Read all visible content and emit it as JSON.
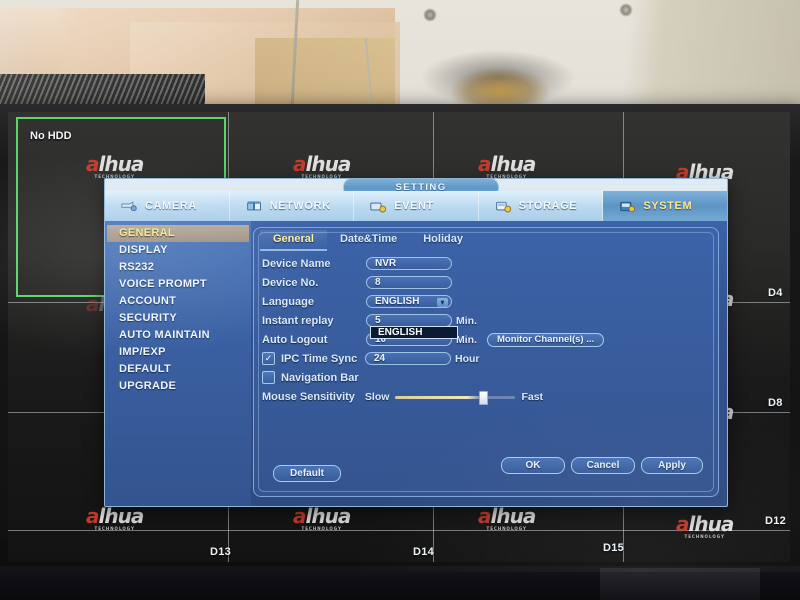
{
  "device_screen": {
    "no_hdd_text": "No HDD",
    "watermark_brand": "alhua",
    "watermark_tagline": "TECHNOLOGY",
    "channel_labels": [
      "D4",
      "D8",
      "D12",
      "D13",
      "D14",
      "D15"
    ]
  },
  "dialog": {
    "title": "SETTING",
    "tabs": [
      {
        "label": "CAMERA",
        "icon": "camera-icon",
        "active": false
      },
      {
        "label": "NETWORK",
        "icon": "network-icon",
        "active": false
      },
      {
        "label": "EVENT",
        "icon": "event-icon",
        "active": false
      },
      {
        "label": "STORAGE",
        "icon": "storage-icon",
        "active": false
      },
      {
        "label": "SYSTEM",
        "icon": "system-icon",
        "active": true
      }
    ],
    "sidebar": [
      {
        "label": "GENERAL",
        "active": true
      },
      {
        "label": "DISPLAY",
        "active": false
      },
      {
        "label": "RS232",
        "active": false
      },
      {
        "label": "VOICE PROMPT",
        "active": false
      },
      {
        "label": "ACCOUNT",
        "active": false
      },
      {
        "label": "SECURITY",
        "active": false
      },
      {
        "label": "AUTO MAINTAIN",
        "active": false
      },
      {
        "label": "IMP/EXP",
        "active": false
      },
      {
        "label": "DEFAULT",
        "active": false
      },
      {
        "label": "UPGRADE",
        "active": false
      }
    ],
    "subtabs": [
      {
        "label": "General",
        "active": true
      },
      {
        "label": "Date&Time",
        "active": false
      },
      {
        "label": "Holiday",
        "active": false
      }
    ],
    "form": {
      "device_name": {
        "label": "Device Name",
        "value": "NVR"
      },
      "device_no": {
        "label": "Device No.",
        "value": "8"
      },
      "language": {
        "label": "Language",
        "value": "ENGLISH",
        "dropdown_open": true,
        "option_highlighted": "ENGLISH"
      },
      "instant_replay": {
        "label": "Instant replay",
        "value": "5",
        "unit": "Min."
      },
      "auto_logout": {
        "label": "Auto Logout",
        "value": "10",
        "unit": "Min.",
        "button": "Monitor Channel(s) ..."
      },
      "ipc_time_sync": {
        "label": "IPC Time Sync",
        "value": "24",
        "unit": "Hour",
        "checked": true
      },
      "navigation_bar": {
        "label": "Navigation Bar",
        "checked": false
      },
      "mouse_sensitivity": {
        "label": "Mouse Sensitivity",
        "min_label": "Slow",
        "max_label": "Fast",
        "percent": 72
      }
    },
    "buttons": {
      "default": "Default",
      "ok": "OK",
      "cancel": "Cancel",
      "apply": "Apply"
    }
  },
  "colors": {
    "dialog_body": "#34548f",
    "accent_yellow": "#ffef9e",
    "tab_active": "#5d94c4",
    "brand_red": "#d43f2e",
    "green_box": "#5bd46a"
  }
}
